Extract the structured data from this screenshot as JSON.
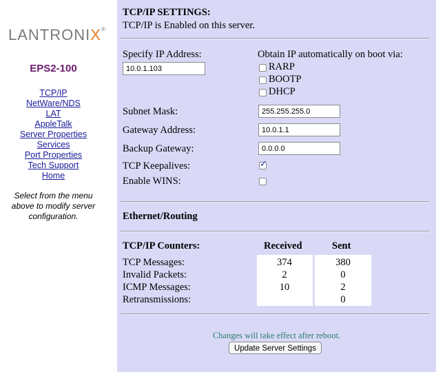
{
  "brand": {
    "logo_main": "LANTRONI",
    "logo_x": "X",
    "logo_tm": "®",
    "model": "EPS2-100"
  },
  "menu": [
    {
      "label": "TCP/IP"
    },
    {
      "label": "NetWare/NDS"
    },
    {
      "label": "LAT"
    },
    {
      "label": "AppleTalk"
    },
    {
      "label": "Server Properties"
    },
    {
      "label": "Services"
    },
    {
      "label": "Port Properties"
    },
    {
      "label": "Tech Support"
    },
    {
      "label": "Home"
    }
  ],
  "hint": [
    "Select from the menu",
    "above to modify server",
    "configuration."
  ],
  "tcpip": {
    "title": "TCP/IP SETTINGS:",
    "status": "TCP/IP is Enabled on this server.",
    "ip_label": "Specify IP Address:",
    "ip_value": "10.0.1.103",
    "obtain_label": "Obtain IP automatically on boot via:",
    "rarp": {
      "label": "RARP",
      "checked": false
    },
    "bootp": {
      "label": "BOOTP",
      "checked": false
    },
    "dhcp": {
      "label": "DHCP",
      "checked": false
    },
    "subnet_label": "Subnet Mask:",
    "subnet_value": "255.255.255.0",
    "gateway_label": "Gateway Address:",
    "gateway_value": "10.0.1.1",
    "backup_label": "Backup Gateway:",
    "backup_value": "0.0.0.0",
    "keepalive_label": "TCP Keepalives:",
    "keepalive_checked": true,
    "wins_label": "Enable WINS:",
    "wins_checked": false
  },
  "ethernet": {
    "title": "Ethernet/Routing"
  },
  "counters": {
    "title": "TCP/IP Counters:",
    "received_header": "Received",
    "sent_header": "Sent",
    "rows": [
      {
        "label": "TCP Messages:",
        "received": "374",
        "sent": "380"
      },
      {
        "label": "Invalid Packets:",
        "received": "2",
        "sent": "0"
      },
      {
        "label": "ICMP Messages:",
        "received": "10",
        "sent": "2"
      },
      {
        "label": "Retransmissions:",
        "received": "",
        "sent": "0"
      }
    ]
  },
  "footer": {
    "note": "Changes will take effect after reboot.",
    "button": "Update Server Settings"
  },
  "colors": {
    "panel": "#d9d9f7",
    "model": "#6b1a6b",
    "link": "#1a1a9c",
    "note": "#2a7a6a",
    "logo_x": "#e87c1e"
  }
}
